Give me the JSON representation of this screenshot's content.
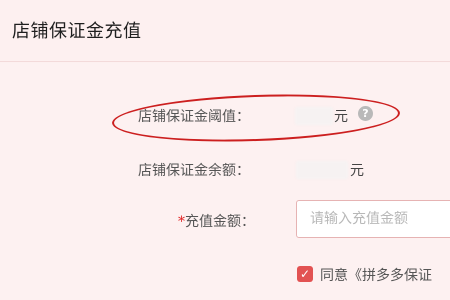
{
  "header": {
    "title": "店铺保证金充值"
  },
  "form": {
    "threshold_label": "店铺保证金阈值：",
    "threshold_unit": "元",
    "threshold_help_icon": "question-circle-icon",
    "balance_label": "店铺保证金余额：",
    "balance_unit": "元",
    "amount_required_mark": "*",
    "amount_label": "充值金额：",
    "amount_placeholder": "请输入充值金额",
    "amount_value": "",
    "agree_checked": true,
    "agree_prefix": "同意",
    "agree_link": "《拼多多保证"
  },
  "colors": {
    "background": "#fdf0f0",
    "annotation_circle": "#cc1f1f",
    "checkbox": "#e25252",
    "required": "#e02020"
  }
}
